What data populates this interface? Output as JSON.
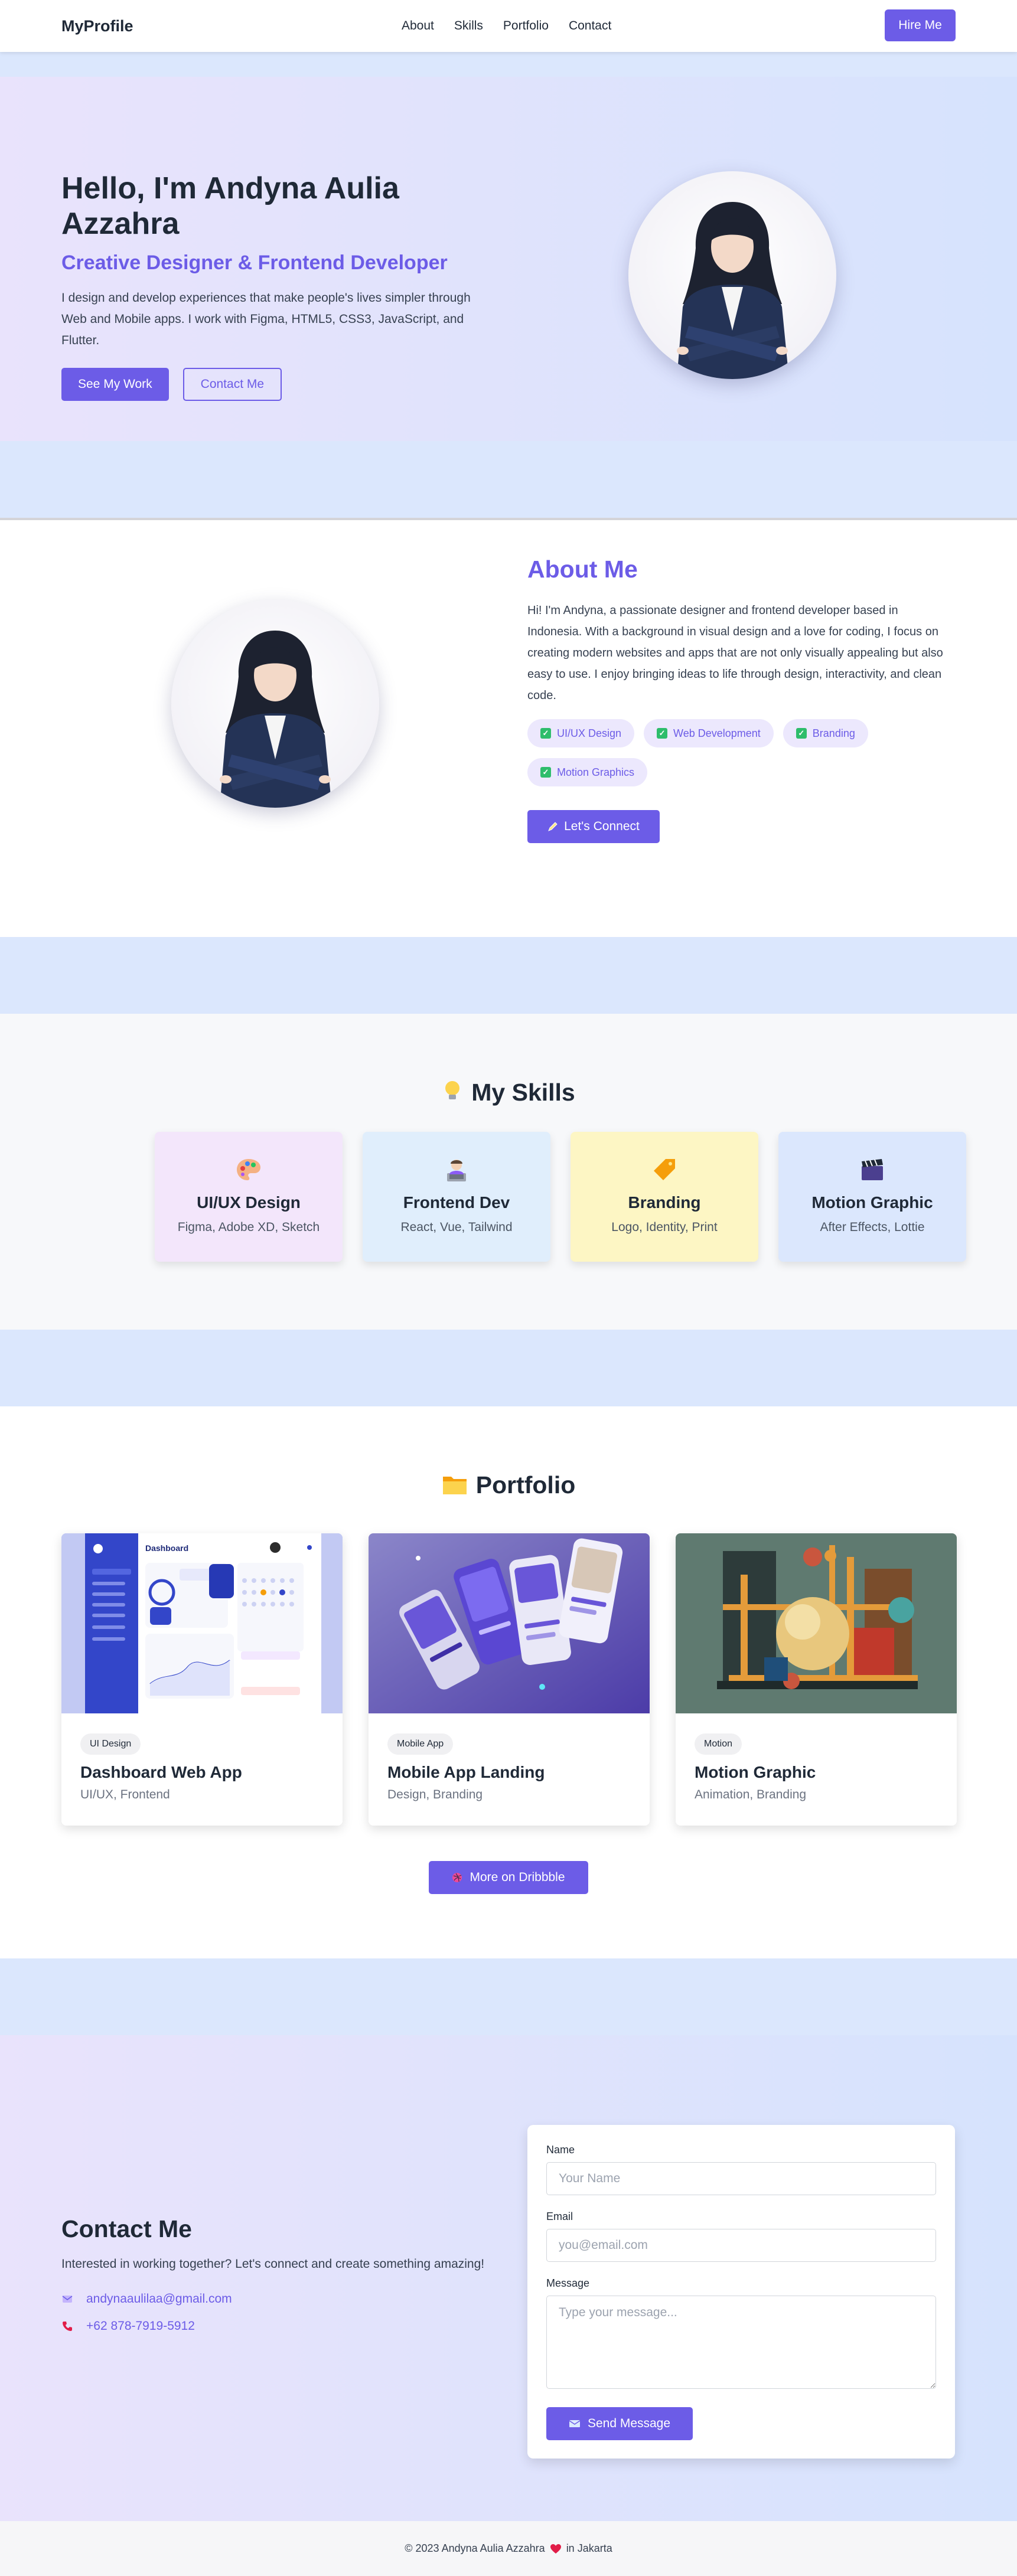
{
  "nav": {
    "brand": "MyProfile",
    "links": [
      "About",
      "Skills",
      "Portfolio",
      "Contact"
    ],
    "hire_label": "Hire Me"
  },
  "hero": {
    "title": "Hello, I'm Andyna Aulia Azzahra",
    "subtitle": "Creative Designer & Frontend Developer",
    "description": "I design and develop experiences that make people's lives simpler through Web and Mobile apps. I work with Figma, HTML5, CSS3, JavaScript, and Flutter.",
    "primary_button": "See My Work",
    "secondary_button": "Contact Me"
  },
  "about": {
    "title": "About Me",
    "description": "Hi! I'm Andyna, a passionate designer and frontend developer based in Indonesia. With a background in visual design and a love for coding, I focus on creating modern websites and apps that are not only visually appealing but also easy to use. I enjoy bringing ideas to life through design, interactivity, and clean code.",
    "tags": [
      "UI/UX Design",
      "Web Development",
      "Branding",
      "Motion Graphics"
    ],
    "connect_label": "Let's Connect"
  },
  "skills": {
    "title": "My Skills",
    "items": [
      {
        "name": "UI/UX Design",
        "tools": "Figma, Adobe XD, Sketch",
        "icon": "palette-icon",
        "bg": "#f3e6fb"
      },
      {
        "name": "Frontend Dev",
        "tools": "React, Vue, Tailwind",
        "icon": "developer-icon",
        "bg": "#e0eefc"
      },
      {
        "name": "Branding",
        "tools": "Logo, Identity, Print",
        "icon": "label-tag-icon",
        "bg": "#fdf6c4"
      },
      {
        "name": "Motion Graphic",
        "tools": "After Effects, Lottie",
        "icon": "clapperboard-icon",
        "bg": "#dbe7fd"
      }
    ]
  },
  "portfolio": {
    "title": "Portfolio",
    "items": [
      {
        "category": "UI Design",
        "title": "Dashboard Web App",
        "meta": "UI/UX, Frontend",
        "thumb_label": "Dashboard"
      },
      {
        "category": "Mobile App",
        "title": "Mobile App Landing",
        "meta": "Design, Branding"
      },
      {
        "category": "Motion",
        "title": "Motion Graphic",
        "meta": "Animation, Branding"
      }
    ],
    "more_label": "More on Dribbble"
  },
  "contact": {
    "title": "Contact Me",
    "intro": "Interested in working together? Let's connect and create something amazing!",
    "email": "andynaaulilaa@gmail.com",
    "phone": "+62 878-7919-5912",
    "form": {
      "name_label": "Name",
      "name_placeholder": "Your Name",
      "email_label": "Email",
      "email_placeholder": "you@email.com",
      "message_label": "Message",
      "message_placeholder": "Type your message...",
      "send_label": "Send Message"
    }
  },
  "footer": {
    "text_before": "© 2023 Andyna Aulia Azzahra",
    "text_after": "in Jakarta"
  },
  "colors": {
    "accent": "#6c5ce7",
    "nav_bg": "#ffffff",
    "hero_gradient_start": "#e9e3fc",
    "hero_gradient_end": "#d6e3fd",
    "tag_bg": "#ece8fd",
    "check_green": "#2ebd6b"
  }
}
